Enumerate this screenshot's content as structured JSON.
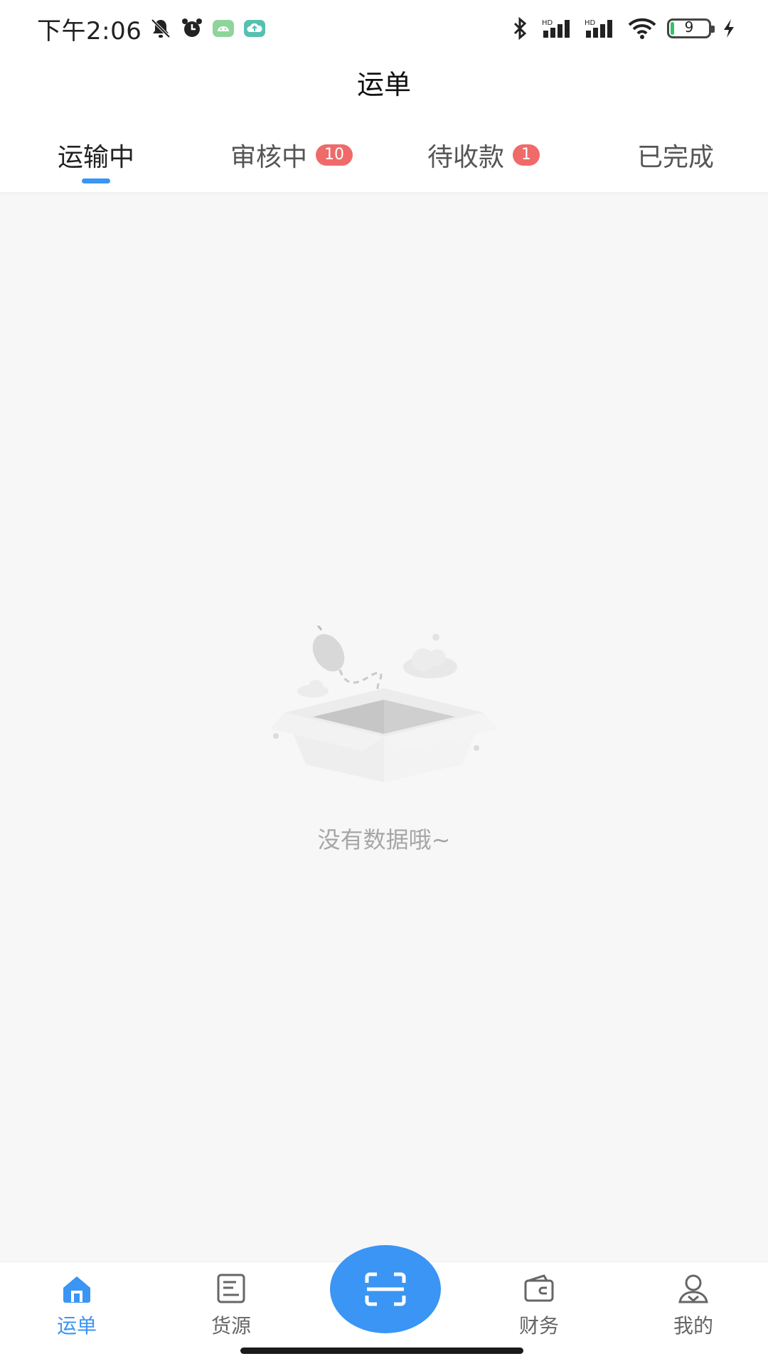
{
  "status_bar": {
    "time": "下午2:06",
    "battery_level": "9"
  },
  "header": {
    "title": "运单"
  },
  "tabs": [
    {
      "label": "运输中",
      "active": true
    },
    {
      "label": "审核中",
      "badge": "10"
    },
    {
      "label": "待收款",
      "badge": "1"
    },
    {
      "label": "已完成"
    }
  ],
  "empty_state": {
    "message": "没有数据哦~"
  },
  "bottom_nav": {
    "items": [
      {
        "label": "运单",
        "icon": "home-icon",
        "active": true
      },
      {
        "label": "货源",
        "icon": "list-icon"
      },
      {
        "label": "财务",
        "icon": "wallet-icon"
      },
      {
        "label": "我的",
        "icon": "user-icon"
      }
    ],
    "center_icon": "scan-icon"
  },
  "colors": {
    "accent": "#3a95f4",
    "badge": "#f06a6a",
    "background": "#f7f7f7"
  }
}
